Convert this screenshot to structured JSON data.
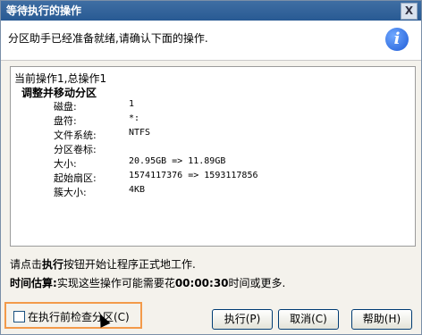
{
  "window": {
    "title": "等待执行的操作",
    "close_label": "X"
  },
  "header": {
    "message": "分区助手已经准备就绪,请确认下面的操作.",
    "icon": "info-icon"
  },
  "operations": {
    "title": "当前操作1,总操作1",
    "op_name": "调整并移动分区",
    "details": [
      {
        "key": "磁盘:",
        "value": "1"
      },
      {
        "key": "盘符:",
        "value": "*:"
      },
      {
        "key": "文件系统:",
        "value": "NTFS"
      },
      {
        "key": "分区卷标:",
        "value": ""
      },
      {
        "key": "大小:",
        "value": "20.95GB => 11.89GB"
      },
      {
        "key": "起始扇区:",
        "value": "1574117376 => 1593117856"
      },
      {
        "key": "簇大小:",
        "value": "4KB"
      }
    ]
  },
  "hint": {
    "prefix": "请点击",
    "action": "执行",
    "suffix": "按钮开始让程序正式地工作."
  },
  "estimate": {
    "label": "时间估算:",
    "text_before": "实现这些操作可能需要花",
    "time": "00:00:30",
    "text_after": "时间或更多."
  },
  "checkbox": {
    "label": "在执行前检查分区(C)",
    "checked": false
  },
  "buttons": {
    "execute": "执行(P)",
    "cancel": "取消(C)",
    "help": "帮助(H)"
  }
}
